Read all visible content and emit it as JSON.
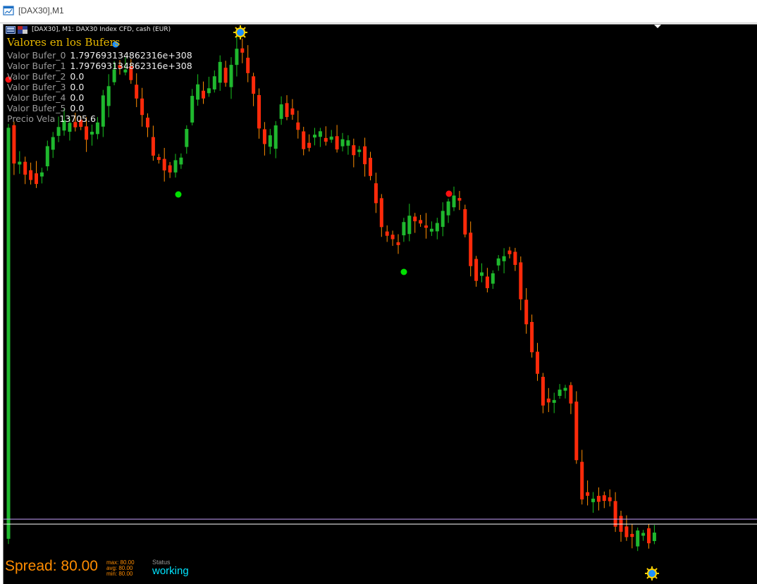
{
  "window": {
    "title": "[DAX30],M1",
    "app_icon": "chart-window-icon"
  },
  "chart_header": {
    "text": "[DAX30], M1:  DAX30 Index CFD, cash (EUR)",
    "icons": [
      "chart-properties-icon",
      "flag-icon"
    ]
  },
  "buffers_panel": {
    "title": "Valores en los Bufers",
    "rows": [
      {
        "label": "Valor Bufer_0",
        "value": "1.797693134862316e+308"
      },
      {
        "label": "Valor Bufer_1",
        "value": "1.797693134862316e+308"
      },
      {
        "label": "Valor Bufer_2",
        "value": "0.0"
      },
      {
        "label": "Valor Bufer_3",
        "value": "0.0"
      },
      {
        "label": "Valor Bufer_4",
        "value": "0.0"
      },
      {
        "label": "Valor Bufer_5",
        "value": "0.0"
      },
      {
        "label": "Precio Vela",
        "value": "13705.6"
      }
    ]
  },
  "spread_panel": {
    "spread_text": "Spread: 80.00",
    "max_text": "max: 80.00",
    "avg_text": "avg: 80.00",
    "min_text": "min: 80.00",
    "status_label": "Status",
    "status_value": "working"
  },
  "colors": {
    "background": "#000000",
    "bull": "#1fb82e",
    "bear": "#ff2a0a",
    "wick_bull": "#17c21e",
    "wick_bear": "#ff8c00",
    "dot_green": "#00e000",
    "dot_red": "#ff1010",
    "dot_blue": "#1e90ff",
    "line_violet": "#c8a2ff",
    "line_white": "#ffffff",
    "spread": "#ff8c00",
    "status": "#00e5ff"
  },
  "chart_data": {
    "type": "candlestick",
    "symbol": "DAX30",
    "timeframe": "M1",
    "description": "DAX30 Index CFD, cash (EUR)",
    "trend": "down",
    "last_price": 13705.6,
    "candle_count": 117,
    "markers": [
      {
        "type": "sun-marker",
        "color": "yellow/blue",
        "at": "top"
      },
      {
        "type": "sun-marker",
        "color": "yellow/blue",
        "at": "bottom"
      },
      {
        "type": "dot",
        "color": "green"
      },
      {
        "type": "dot",
        "color": "green"
      },
      {
        "type": "dot",
        "color": "red"
      },
      {
        "type": "dot",
        "color": "red"
      },
      {
        "type": "dot",
        "color": "blue"
      }
    ]
  }
}
